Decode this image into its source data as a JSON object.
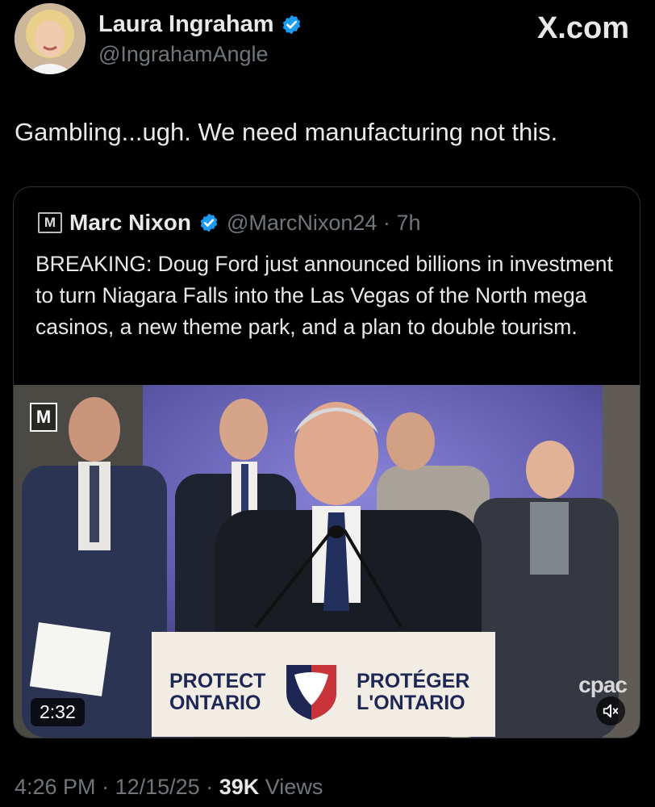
{
  "author": {
    "name": "Laura Ingraham",
    "handle": "@IngrahamAngle",
    "verified": true
  },
  "brand": {
    "label": "X.com"
  },
  "tweet": {
    "text": "Gambling...ugh.  We need manufacturing not this."
  },
  "quoted": {
    "logo_letter": "M",
    "name": "Marc Nixon",
    "handle": "@MarcNixon24",
    "separator": "·",
    "age": "7h",
    "text": "BREAKING: Doug Ford just announced billions in investment to turn Niagara Falls into the Las Vegas of the North mega casinos, a new theme park, and a plan to double tourism.",
    "video": {
      "watermark": "M",
      "duration": "2:32",
      "broadcaster": "cpac",
      "podium_left": "PROTECT ONTARIO",
      "podium_right": "PROTÉGER L'ONTARIO",
      "muted": true
    }
  },
  "meta": {
    "time": "4:26 PM",
    "date": "12/15/25",
    "views_count": "39K",
    "views_label": "Views",
    "sep": "·"
  },
  "colors": {
    "background": "#000000",
    "text": "#e7e9ea",
    "muted": "#71767b",
    "verified": "#1d9bf0",
    "border": "#2f3336"
  }
}
